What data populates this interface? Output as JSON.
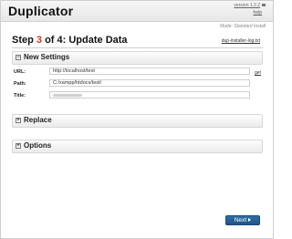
{
  "header": {
    "title": "Duplicator",
    "version": "version 1.2.2",
    "help": "help"
  },
  "mode": "Mode: Standard Install",
  "step": {
    "prefix": "Step ",
    "number": "3",
    "suffix": " of 4: Update Data"
  },
  "log_link": "dup-installer-log.txt",
  "panels": {
    "new_settings": {
      "label": "New Settings",
      "toggle": "−"
    },
    "replace": {
      "label": "Replace",
      "toggle": "+"
    },
    "options": {
      "label": "Options",
      "toggle": "+"
    }
  },
  "fields": {
    "url": {
      "label": "URL:",
      "value": "http://localhost/test"
    },
    "path": {
      "label": "Path:",
      "value": "C:/xampp/htdocs/test/"
    },
    "title": {
      "label": "Title:"
    }
  },
  "get_link": "get",
  "next_button": {
    "label": "Next"
  },
  "colors": {
    "accent_step": "#cc3b16",
    "button_bg": "#24609a",
    "panel_bg": "#f2f2f2"
  }
}
